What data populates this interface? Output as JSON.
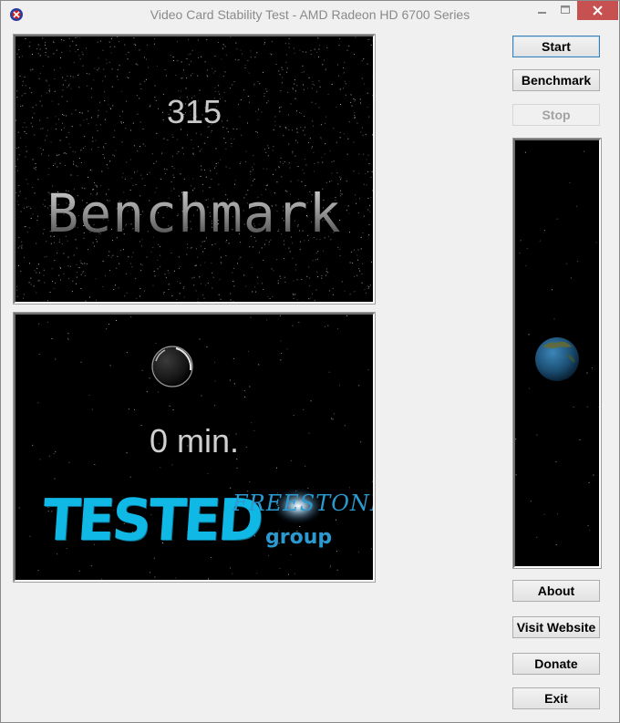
{
  "window": {
    "title": "Video Card Stability Test - AMD Radeon HD 6700 Series",
    "controls": {
      "minimize": "minimize",
      "maximize": "maximize",
      "close": "close"
    }
  },
  "benchmark_panel": {
    "score": "315",
    "label": "Benchmark"
  },
  "test_panel": {
    "elapsed": "0 min.",
    "stamp": "TESTED",
    "logo_name": "FREESTONE",
    "logo_group": "group"
  },
  "buttons": {
    "start": "Start",
    "benchmark": "Benchmark",
    "stop": "Stop",
    "about": "About",
    "visit_website": "Visit Website",
    "donate": "Donate",
    "exit": "Exit"
  },
  "colors": {
    "stamp": "#10b8e6",
    "logo": "#2a9ad0",
    "close_button": "#c75050",
    "panel_background": "#000000"
  },
  "icons": [
    "app-icon",
    "minimize-icon",
    "maximize-icon",
    "close-icon",
    "moon-icon",
    "earth-icon"
  ]
}
